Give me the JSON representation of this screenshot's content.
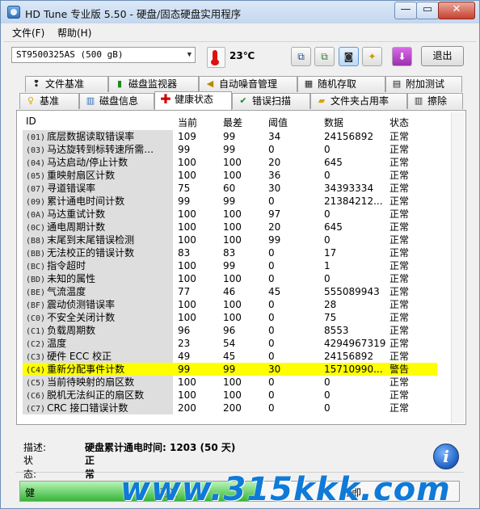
{
  "window": {
    "title": "HD Tune 专业版 5.50 - 硬盘/固态硬盘实用程序"
  },
  "menu": {
    "file": "文件(F)",
    "help": "帮助(H)"
  },
  "toolbar": {
    "drive": "ST9500325AS (500 gB)",
    "temperature": "23℃",
    "exit_label": "退出"
  },
  "tabs_top": [
    {
      "label": "文件基准",
      "icon": "file-benchmark-icon"
    },
    {
      "label": "磁盘监视器",
      "icon": "disk-monitor-icon"
    },
    {
      "label": "自动噪音管理",
      "icon": "speaker-icon"
    },
    {
      "label": "随机存取",
      "icon": "random-access-icon"
    },
    {
      "label": "附加测试",
      "icon": "extra-tests-icon"
    }
  ],
  "tabs_bottom": [
    {
      "label": "基准",
      "icon": "lightbulb-icon"
    },
    {
      "label": "磁盘信息",
      "icon": "disk-info-icon"
    },
    {
      "label": "健康状态",
      "icon": "health-cross-icon"
    },
    {
      "label": "错误扫描",
      "icon": "error-scan-icon"
    },
    {
      "label": "文件夹占用率",
      "icon": "folder-icon"
    },
    {
      "label": "擦除",
      "icon": "trash-icon"
    }
  ],
  "table": {
    "headers": [
      "ID",
      "当前",
      "最差",
      "阈值",
      "数据",
      "状态"
    ],
    "rows": [
      {
        "id": "(01)",
        "name": "底层数据读取错误率",
        "current": "109",
        "worst": "99",
        "threshold": "34",
        "data": "24156892",
        "status": "正常",
        "highlight": false
      },
      {
        "id": "(03)",
        "name": "马达旋转到标转速所需…",
        "current": "99",
        "worst": "99",
        "threshold": "0",
        "data": "0",
        "status": "正常",
        "highlight": false
      },
      {
        "id": "(04)",
        "name": "马达启动/停止计数",
        "current": "100",
        "worst": "100",
        "threshold": "20",
        "data": "645",
        "status": "正常",
        "highlight": false
      },
      {
        "id": "(05)",
        "name": "重映射扇区计数",
        "current": "100",
        "worst": "100",
        "threshold": "36",
        "data": "0",
        "status": "正常",
        "highlight": false
      },
      {
        "id": "(07)",
        "name": "寻道错误率",
        "current": "75",
        "worst": "60",
        "threshold": "30",
        "data": "34393334",
        "status": "正常",
        "highlight": false
      },
      {
        "id": "(09)",
        "name": "累计通电时间计数",
        "current": "99",
        "worst": "99",
        "threshold": "0",
        "data": "21384212...",
        "status": "正常",
        "highlight": false
      },
      {
        "id": "(0A)",
        "name": "马达重试计数",
        "current": "100",
        "worst": "100",
        "threshold": "97",
        "data": "0",
        "status": "正常",
        "highlight": false
      },
      {
        "id": "(0C)",
        "name": "通电周期计数",
        "current": "100",
        "worst": "100",
        "threshold": "20",
        "data": "645",
        "status": "正常",
        "highlight": false
      },
      {
        "id": "(B8)",
        "name": "末尾到末尾错误检测",
        "current": "100",
        "worst": "100",
        "threshold": "99",
        "data": "0",
        "status": "正常",
        "highlight": false
      },
      {
        "id": "(BB)",
        "name": "无法校正的错误计数",
        "current": "83",
        "worst": "83",
        "threshold": "0",
        "data": "17",
        "status": "正常",
        "highlight": false
      },
      {
        "id": "(BC)",
        "name": "指令超时",
        "current": "100",
        "worst": "99",
        "threshold": "0",
        "data": "1",
        "status": "正常",
        "highlight": false
      },
      {
        "id": "(BD)",
        "name": "未知的属性",
        "current": "100",
        "worst": "100",
        "threshold": "0",
        "data": "0",
        "status": "正常",
        "highlight": false
      },
      {
        "id": "(BE)",
        "name": "气流温度",
        "current": "77",
        "worst": "46",
        "threshold": "45",
        "data": "555089943",
        "status": "正常",
        "highlight": false
      },
      {
        "id": "(BF)",
        "name": "震动侦测错误率",
        "current": "100",
        "worst": "100",
        "threshold": "0",
        "data": "28",
        "status": "正常",
        "highlight": false
      },
      {
        "id": "(C0)",
        "name": "不安全关闭计数",
        "current": "100",
        "worst": "100",
        "threshold": "0",
        "data": "75",
        "status": "正常",
        "highlight": false
      },
      {
        "id": "(C1)",
        "name": "负载周期数",
        "current": "96",
        "worst": "96",
        "threshold": "0",
        "data": "8553",
        "status": "正常",
        "highlight": false
      },
      {
        "id": "(C2)",
        "name": "温度",
        "current": "23",
        "worst": "54",
        "threshold": "0",
        "data": "4294967319",
        "status": "正常",
        "highlight": false
      },
      {
        "id": "(C3)",
        "name": "硬件 ECC 校正",
        "current": "49",
        "worst": "45",
        "threshold": "0",
        "data": "24156892",
        "status": "正常",
        "highlight": false
      },
      {
        "id": "(C4)",
        "name": "重新分配事件计数",
        "current": "99",
        "worst": "99",
        "threshold": "30",
        "data": "15710990...",
        "status": "警告",
        "highlight": true
      },
      {
        "id": "(C5)",
        "name": "当前待映射的扇区数",
        "current": "100",
        "worst": "100",
        "threshold": "0",
        "data": "0",
        "status": "正常",
        "highlight": false
      },
      {
        "id": "(C6)",
        "name": "脱机无法纠正的扇区数",
        "current": "100",
        "worst": "100",
        "threshold": "0",
        "data": "0",
        "status": "正常",
        "highlight": false
      },
      {
        "id": "(C7)",
        "name": "CRC 接口错误计数",
        "current": "200",
        "worst": "200",
        "threshold": "0",
        "data": "0",
        "status": "正常",
        "highlight": false
      }
    ]
  },
  "details": {
    "description_label": "描述:",
    "description_value": "硬盘累计通电时间: 1203 (50 天)",
    "status_label": "状态:",
    "status_value": "正常"
  },
  "progress": {
    "left_label": "健",
    "middle_label": "刷新",
    "right_label": "立即",
    "level_fraction": 0.55
  },
  "watermark": "www.315kkk.com",
  "colors": {
    "highlight_row": "#ffff00",
    "id_column_bg": "#dedede",
    "watermark": "#0f7ad8"
  }
}
